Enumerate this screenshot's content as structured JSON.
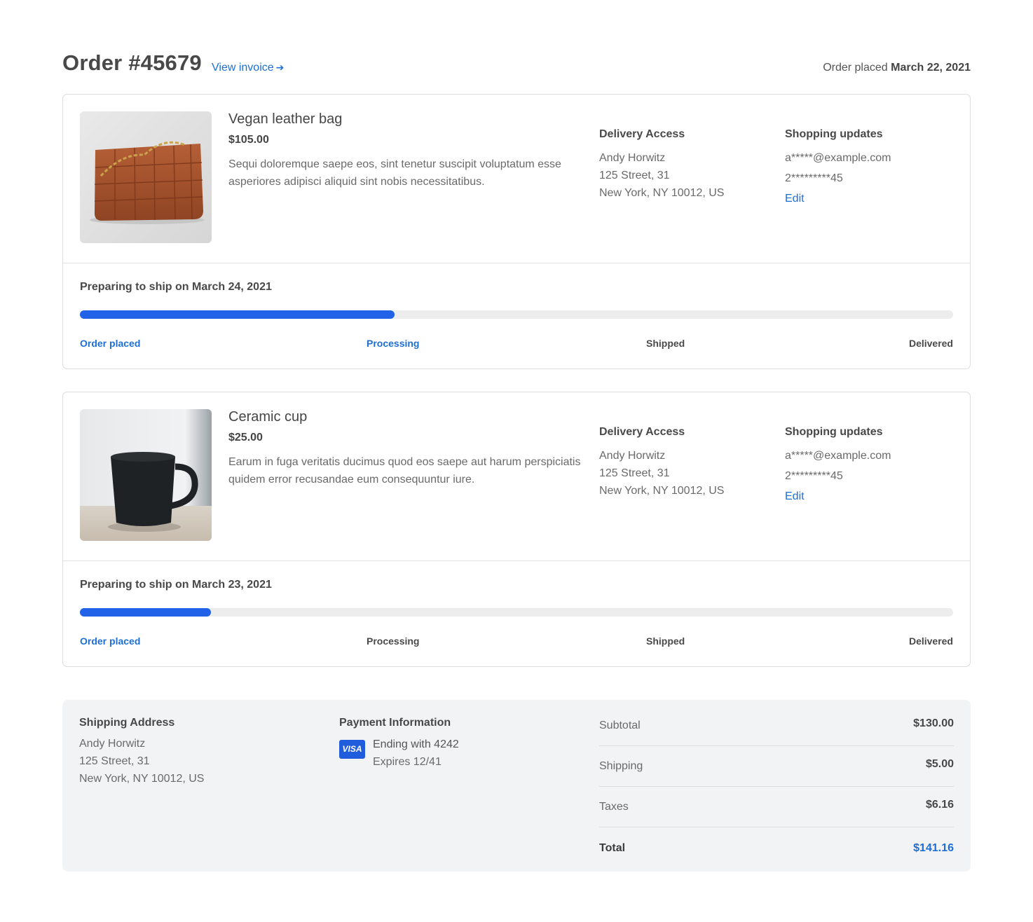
{
  "header": {
    "order_title": "Order #45679",
    "view_invoice": "View invoice",
    "placed_prefix": "Order placed",
    "placed_date": "March 22, 2021"
  },
  "orders": [
    {
      "name": "Vegan leather bag",
      "price": "$105.00",
      "description": "Sequi doloremque saepe eos, sint tenetur suscipit voluptatum esse asperiores adipisci aliquid sint nobis necessitatibus.",
      "delivery": {
        "title": "Delivery Access",
        "name": "Andy Horwitz",
        "street": "125 Street, 31",
        "city": "New York, NY 10012, US"
      },
      "updates": {
        "title": "Shopping updates",
        "email": "a*****@example.com",
        "phone": "2*********45",
        "edit": "Edit"
      },
      "status": "Preparing to ship on March 24, 2021",
      "progress_fraction": 0.36,
      "steps": [
        "Order placed",
        "Processing",
        "Shipped",
        "Delivered"
      ],
      "active_steps": 2
    },
    {
      "name": "Ceramic cup",
      "price": "$25.00",
      "description": "Earum in fuga veritatis ducimus quod eos saepe aut harum perspiciatis quidem error recusandae eum consequuntur iure.",
      "delivery": {
        "title": "Delivery Access",
        "name": "Andy Horwitz",
        "street": "125 Street, 31",
        "city": "New York, NY 10012, US"
      },
      "updates": {
        "title": "Shopping updates",
        "email": "a*****@example.com",
        "phone": "2*********45",
        "edit": "Edit"
      },
      "status": "Preparing to ship on March 23, 2021",
      "progress_fraction": 0.15,
      "steps": [
        "Order placed",
        "Processing",
        "Shipped",
        "Delivered"
      ],
      "active_steps": 1
    }
  ],
  "summary": {
    "shipping": {
      "title": "Shipping Address",
      "name": "Andy Horwitz",
      "street": "125 Street, 31",
      "city": "New York, NY 10012, US"
    },
    "payment": {
      "title": "Payment Information",
      "card_brand": "VISA",
      "ending": "Ending with 4242",
      "expires": "Expires 12/41"
    },
    "totals": {
      "subtotal_label": "Subtotal",
      "subtotal": "$130.00",
      "shipping_label": "Shipping",
      "shipping": "$5.00",
      "taxes_label": "Taxes",
      "taxes": "$6.16",
      "total_label": "Total",
      "total": "$141.16"
    }
  },
  "colors": {
    "accent": "#1d6fd6",
    "progress": "#2262e8",
    "summary_bg": "#f2f3f5"
  }
}
